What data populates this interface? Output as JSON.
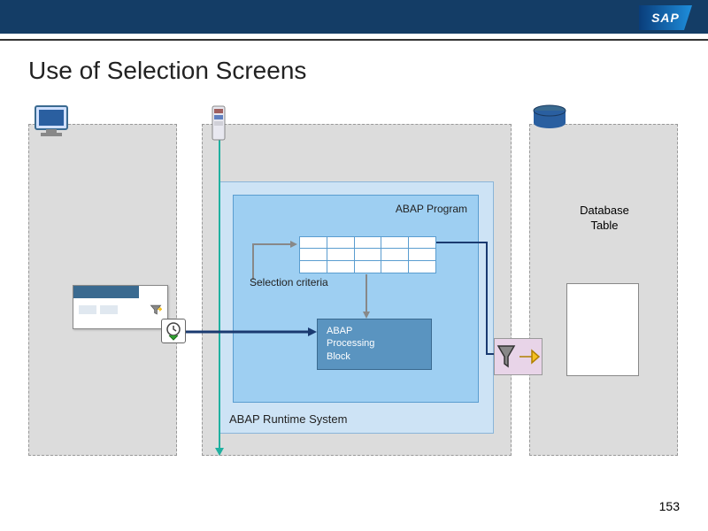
{
  "header": {
    "brand": "SAP"
  },
  "title": "Use of Selection Screens",
  "runtime": {
    "label": "ABAP Runtime System"
  },
  "program": {
    "label": "ABAP Program"
  },
  "criteria": {
    "label": "Selection criteria"
  },
  "processing": {
    "label": "ABAP\nProcessing\nBlock"
  },
  "database": {
    "label": "Database\nTable"
  },
  "page": {
    "number": "153"
  }
}
